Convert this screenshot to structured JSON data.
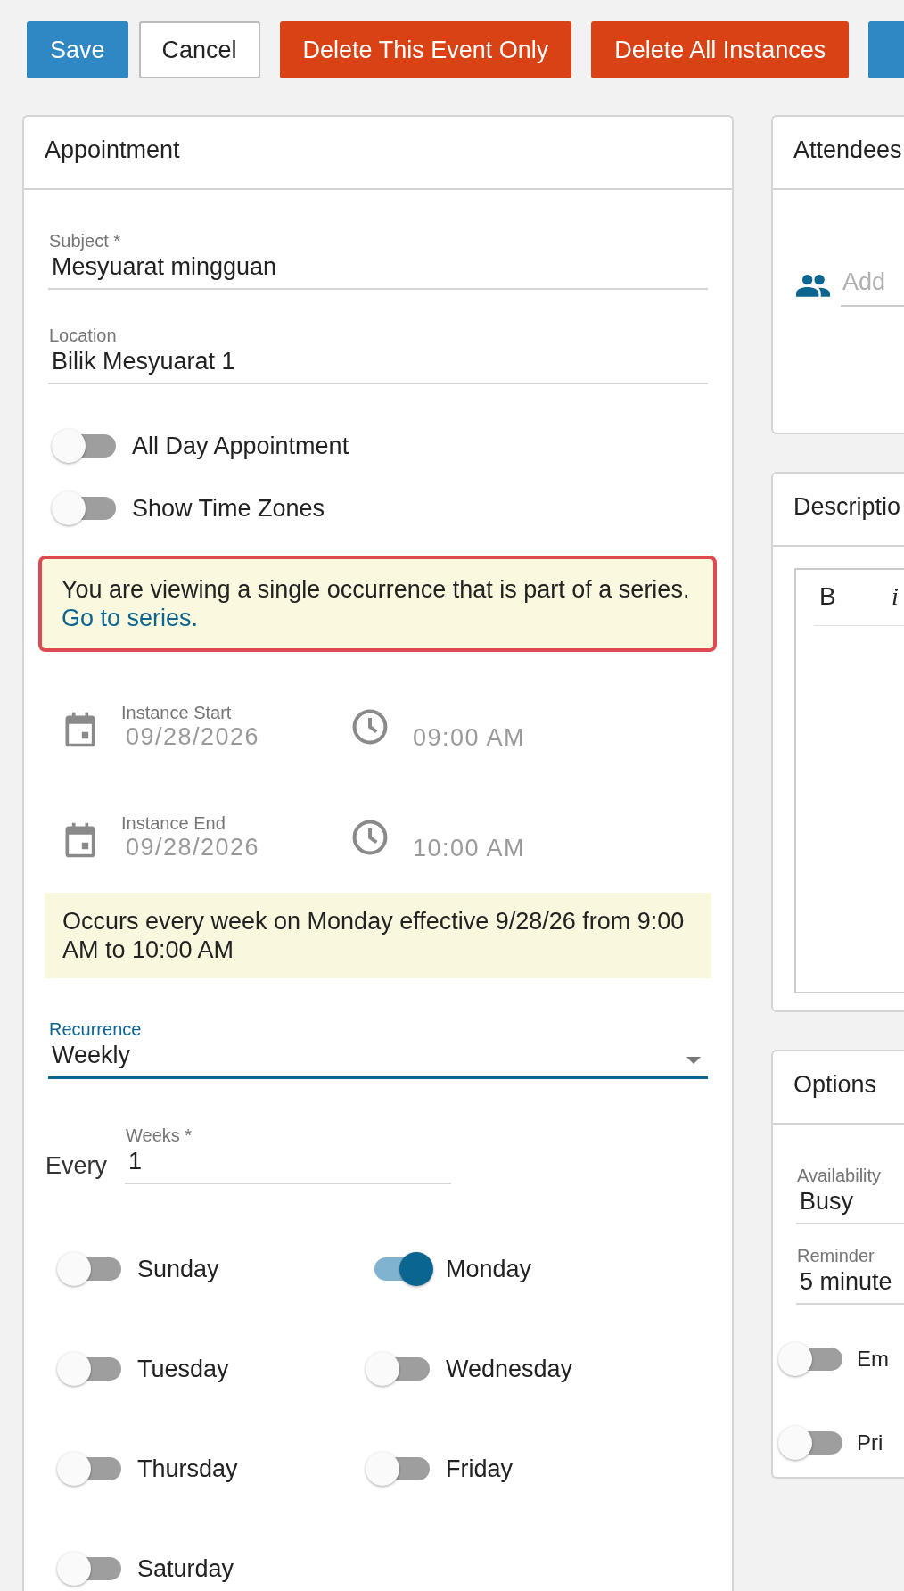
{
  "toolbar": {
    "buttons": [
      {
        "label": "Save",
        "kind": "primary"
      },
      {
        "label": "Cancel",
        "kind": "secondary"
      },
      {
        "label": "Delete This Event Only",
        "kind": "danger"
      },
      {
        "label": "Delete All Instances",
        "kind": "danger"
      },
      {
        "kind": "primary"
      }
    ]
  },
  "appointment": {
    "title": "Appointment",
    "fields": [
      {
        "label": "Subject *",
        "value": "Mesyuarat mingguan"
      },
      {
        "label": "Location",
        "value": "Bilik Mesyuarat 1"
      }
    ],
    "toggles": [
      {
        "label": "All Day Appointment",
        "on": false
      },
      {
        "label": "Show Time Zones",
        "on": false
      }
    ],
    "notice": {
      "text": "You are viewing a single occurrence that is part of a series.",
      "link": "Go to series."
    },
    "instances": [
      {
        "label": "Instance Start",
        "date": "09/28/2026",
        "time": "09:00 AM"
      },
      {
        "label": "Instance End",
        "date": "09/28/2026",
        "time": "10:00 AM"
      }
    ],
    "summary": "Occurs every week on Monday effective 9/28/26 from 9:00 AM to 10:00 AM",
    "recurrence": {
      "label": "Recurrence",
      "value": "Weekly"
    },
    "every": {
      "prefix": "Every",
      "label": "Weeks *",
      "value": "1"
    },
    "days": [
      {
        "label": "Sunday",
        "on": false
      },
      {
        "label": "Monday",
        "on": true
      },
      {
        "label": "Tuesday",
        "on": false
      },
      {
        "label": "Wednesday",
        "on": false
      },
      {
        "label": "Thursday",
        "on": false
      },
      {
        "label": "Friday",
        "on": false
      },
      {
        "label": "Saturday",
        "on": false
      }
    ]
  },
  "attendees": {
    "title": "Attendees",
    "placeholder": "Add"
  },
  "description": {
    "title": "Descriptio",
    "toolbar": [
      "B",
      "i"
    ]
  },
  "options": {
    "title": "Options",
    "fields": [
      {
        "label": "Availability",
        "value": "Busy"
      },
      {
        "label": "Reminder",
        "value": "5 minute"
      }
    ],
    "toggles": [
      {
        "label": "Em",
        "on": false
      },
      {
        "label": "Pri",
        "on": false
      }
    ]
  }
}
